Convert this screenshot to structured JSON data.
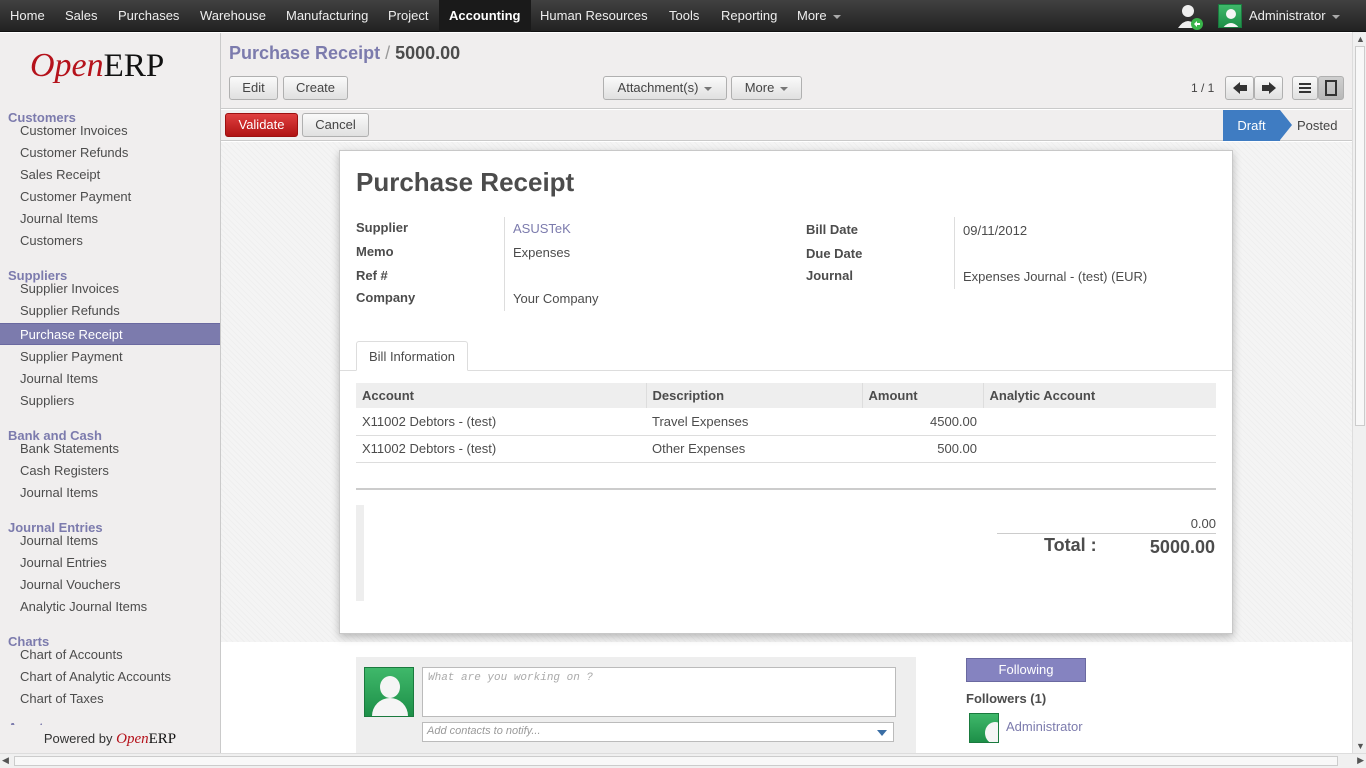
{
  "topnav": {
    "items": [
      "Home",
      "Sales",
      "Purchases",
      "Warehouse",
      "Manufacturing",
      "Project",
      "Accounting",
      "Human Resources",
      "Tools",
      "Reporting",
      "More"
    ],
    "user": "Administrator"
  },
  "sidebar": {
    "logo": {
      "open": "Open",
      "erp": "ERP"
    },
    "sections": [
      {
        "title": "Customers",
        "items": [
          "Customer Invoices",
          "Customer Refunds",
          "Sales Receipt",
          "Customer Payment",
          "Journal Items",
          "Customers"
        ]
      },
      {
        "title": "Suppliers",
        "items": [
          "Supplier Invoices",
          "Supplier Refunds",
          "Purchase Receipt",
          "Supplier Payment",
          "Journal Items",
          "Suppliers"
        ]
      },
      {
        "title": "Bank and Cash",
        "items": [
          "Bank Statements",
          "Cash Registers",
          "Journal Items"
        ]
      },
      {
        "title": "Journal Entries",
        "items": [
          "Journal Items",
          "Journal Entries",
          "Journal Vouchers",
          "Analytic Journal Items"
        ]
      },
      {
        "title": "Charts",
        "items": [
          "Chart of Accounts",
          "Chart of Analytic Accounts",
          "Chart of Taxes"
        ]
      },
      {
        "title": "Assets",
        "items": []
      }
    ],
    "selected": "Purchase Receipt",
    "powered_by": "Powered by"
  },
  "header": {
    "breadcrumb_parent": "Purchase Receipt",
    "breadcrumb_sep": "/",
    "breadcrumb_current": "5000.00",
    "edit": "Edit",
    "create": "Create",
    "attachments": "Attachment(s)",
    "more": "More",
    "pager": "1 / 1"
  },
  "statusbar": {
    "validate": "Validate",
    "cancel": "Cancel",
    "states": [
      "Draft",
      "Posted"
    ],
    "current_state": "Draft"
  },
  "form": {
    "title": "Purchase Receipt",
    "labels": {
      "supplier": "Supplier",
      "memo": "Memo",
      "ref": "Ref #",
      "company": "Company",
      "bill_date": "Bill Date",
      "due_date": "Due Date",
      "journal": "Journal"
    },
    "values": {
      "supplier": "ASUSTeK",
      "memo": "Expenses",
      "ref": "",
      "company": "Your Company",
      "bill_date": "09/11/2012",
      "due_date": "",
      "journal": "Expenses Journal - (test) (EUR)"
    },
    "tab": "Bill Information",
    "columns": [
      "Account",
      "Description",
      "Amount",
      "Analytic Account"
    ],
    "rows": [
      {
        "account": "X11002 Debtors - (test)",
        "description": "Travel Expenses",
        "amount": "4500.00",
        "analytic": ""
      },
      {
        "account": "X11002 Debtors - (test)",
        "description": "Other Expenses",
        "amount": "500.00",
        "analytic": ""
      }
    ],
    "subtotal": "0.00",
    "total_label": "Total :",
    "total": "5000.00"
  },
  "chatter": {
    "placeholder": "What are you working on ?",
    "add_contacts": "Add contacts to notify...",
    "following": "Following",
    "followers_title": "Followers (1)",
    "followers": [
      "Administrator"
    ]
  },
  "colors": {
    "accent": "#7c7bad",
    "validate": "#c71b1b",
    "draft": "#3f7cc2",
    "avatar": "#2aa35a"
  }
}
